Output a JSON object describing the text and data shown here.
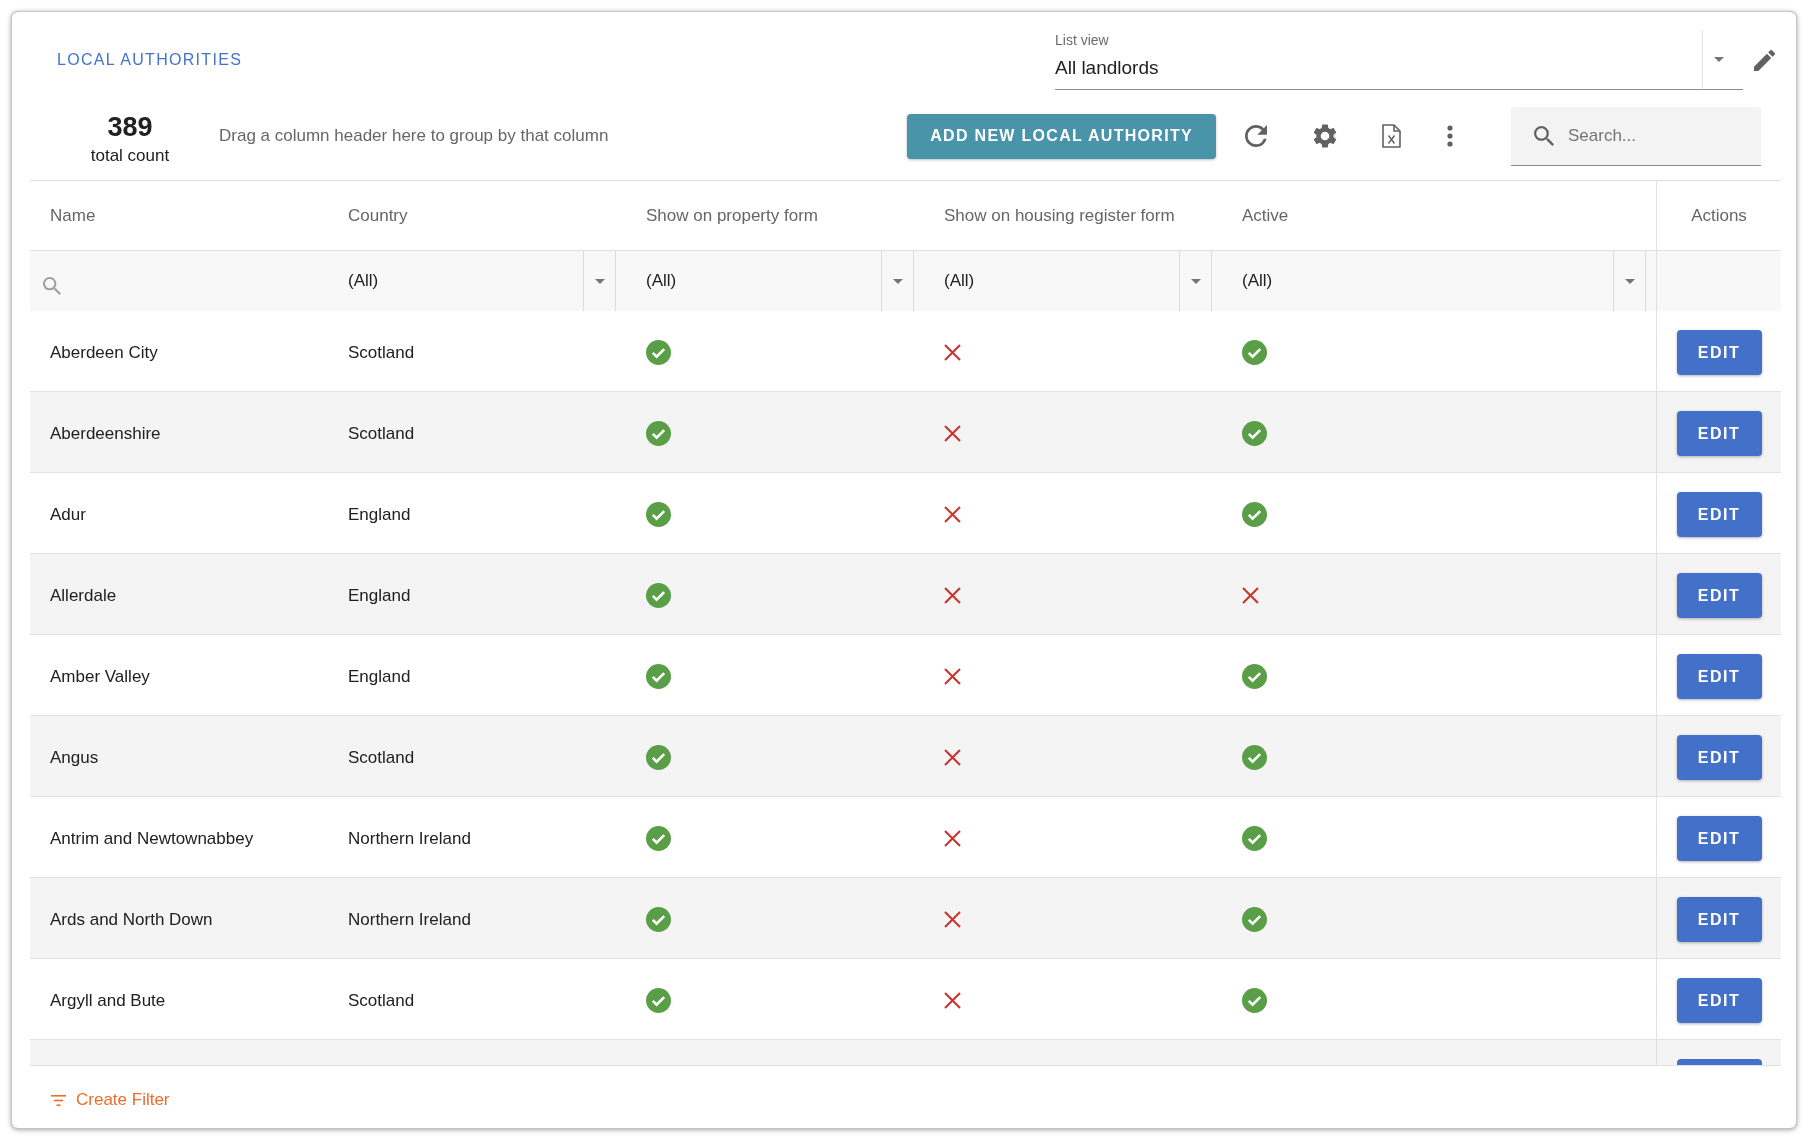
{
  "title": "LOCAL AUTHORITIES",
  "list_view": {
    "label": "List view",
    "value": "All landlords"
  },
  "summary": {
    "count": "389",
    "count_label": "total count",
    "group_hint": "Drag a column header here to group by that column"
  },
  "toolbar": {
    "add_button": "ADD NEW LOCAL AUTHORITY",
    "search": {
      "placeholder": "Search..."
    }
  },
  "table": {
    "columns": [
      "Name",
      "Country",
      "Show on property form",
      "Show on housing register form",
      "Active",
      "Actions"
    ],
    "filters": [
      {
        "kind": "search"
      },
      {
        "kind": "select",
        "value": "(All)"
      },
      {
        "kind": "select",
        "value": "(All)"
      },
      {
        "kind": "select",
        "value": "(All)"
      },
      {
        "kind": "select",
        "value": "(All)"
      }
    ],
    "rows": [
      {
        "name": "Aberdeen City",
        "country": "Scotland",
        "show_on_property_form": true,
        "show_on_housing_register_form": false,
        "active": true,
        "action": "EDIT"
      },
      {
        "name": "Aberdeenshire",
        "country": "Scotland",
        "show_on_property_form": true,
        "show_on_housing_register_form": false,
        "active": true,
        "action": "EDIT"
      },
      {
        "name": "Adur",
        "country": "England",
        "show_on_property_form": true,
        "show_on_housing_register_form": false,
        "active": true,
        "action": "EDIT"
      },
      {
        "name": "Allerdale",
        "country": "England",
        "show_on_property_form": true,
        "show_on_housing_register_form": false,
        "active": false,
        "action": "EDIT"
      },
      {
        "name": "Amber Valley",
        "country": "England",
        "show_on_property_form": true,
        "show_on_housing_register_form": false,
        "active": true,
        "action": "EDIT"
      },
      {
        "name": "Angus",
        "country": "Scotland",
        "show_on_property_form": true,
        "show_on_housing_register_form": false,
        "active": true,
        "action": "EDIT"
      },
      {
        "name": "Antrim and Newtownabbey",
        "country": "Northern Ireland",
        "show_on_property_form": true,
        "show_on_housing_register_form": false,
        "active": true,
        "action": "EDIT"
      },
      {
        "name": "Ards and North Down",
        "country": "Northern Ireland",
        "show_on_property_form": true,
        "show_on_housing_register_form": false,
        "active": true,
        "action": "EDIT"
      },
      {
        "name": "Argyll and Bute",
        "country": "Scotland",
        "show_on_property_form": true,
        "show_on_housing_register_form": false,
        "active": true,
        "action": "EDIT"
      }
    ]
  },
  "footer": {
    "create_filter": "Create Filter"
  }
}
